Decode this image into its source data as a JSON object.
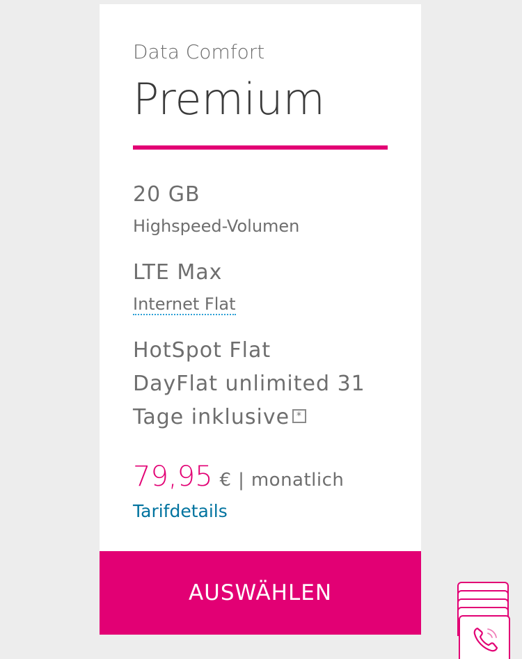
{
  "plan": {
    "subtitle": "Data Comfort",
    "title": "Premium",
    "features": [
      {
        "main": "20 GB",
        "sub": "Highspeed-Volumen"
      },
      {
        "main": "LTE Max",
        "sub": "Internet Flat"
      }
    ],
    "extras": [
      "HotSpot Flat",
      "DayFlat unlimited 31",
      "Tage inklusive"
    ],
    "info_icon_glyph": "*",
    "price": "79,95",
    "currency": "€",
    "separator": "|",
    "period": "monatlich",
    "details_link": "Tarifdetails",
    "select_button": "AUSWÄHLEN"
  },
  "colors": {
    "accent": "#e20074",
    "link": "#00739f",
    "link_underline": "#2a9fd6",
    "text": "#6e6e6e",
    "title": "#3a3a3a",
    "background": "#ededed"
  },
  "icons": {
    "info": "info-icon",
    "contact": "phone-icon"
  }
}
